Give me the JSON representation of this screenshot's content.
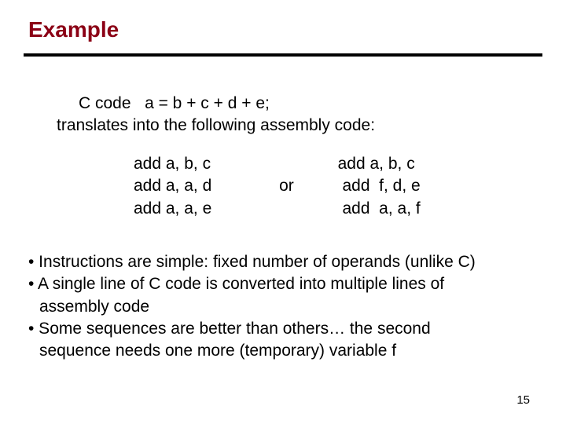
{
  "title": "Example",
  "intro": {
    "line1_prefix": "C code",
    "line1_expr": "a = b + c + d + e;",
    "line2": "translates into the following assembly code:"
  },
  "code": {
    "left": {
      "l1": "add  a, b, c",
      "l2": "add  a, a, d",
      "l3": "add  a, a, e"
    },
    "or": "or",
    "right": {
      "l1": "add  a, b, c",
      "l2": " add  f, d, e",
      "l3": " add  a, a, f"
    }
  },
  "bullets": {
    "b1": "• Instructions are simple: fixed number of operands (unlike C)",
    "b2": "• A single line of C code is converted into multiple lines of",
    "b2c": "assembly code",
    "b3": "• Some sequences are better than others… the second",
    "b3c": "sequence needs one more (temporary) variable  f"
  },
  "pagenum": "15"
}
